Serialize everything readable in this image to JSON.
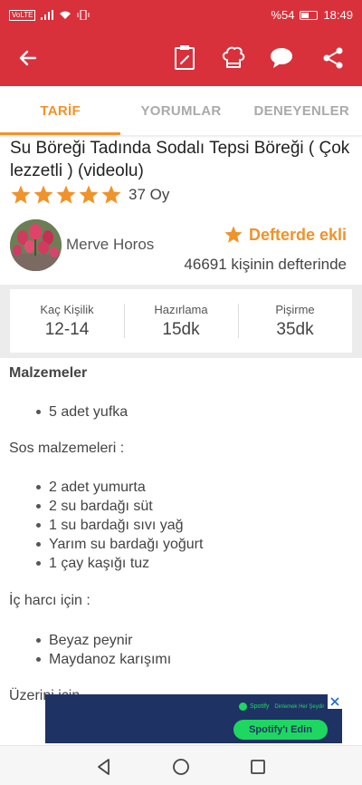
{
  "status_bar": {
    "carrier_badge": "VoLTE",
    "battery_percent": "%54",
    "battery_level": 0.54,
    "time": "18:49"
  },
  "toolbar": {
    "back_icon": "arrow-left-icon",
    "actions": [
      "notebook-icon",
      "chef-hat-icon",
      "chat-bubble-icon",
      "share-icon"
    ]
  },
  "tabs": [
    {
      "label": "TARİF",
      "active": true
    },
    {
      "label": "YORUMLAR",
      "active": false
    },
    {
      "label": "DENEYENLER",
      "active": false
    }
  ],
  "recipe": {
    "title": "Su Böreği Tadında Sodalı Tepsi Böreği ( Çok lezzetli ) (videolu)",
    "stars": 5,
    "vote_text": "37 Oy"
  },
  "author": {
    "name": "Merve Horos",
    "defter_label": "Defterde ekli",
    "defter_count_text": "46691 kişinin defterinde"
  },
  "info": [
    {
      "label": "Kaç Kişilik",
      "value": "12-14"
    },
    {
      "label": "Hazırlama",
      "value": "15dk"
    },
    {
      "label": "Pişirme",
      "value": "35dk"
    }
  ],
  "ingredients": {
    "heading": "Malzemeler",
    "main": [
      "5 adet yufka"
    ],
    "sauce_heading": "Sos malzemeleri :",
    "sauce": [
      "2 adet yumurta",
      "2 su bardağı süt",
      "1 su bardağı sıvı yağ",
      "Yarım su bardağı yoğurt",
      "1 çay kaşığı tuz"
    ],
    "filling_heading": "İç harcı için :",
    "filling": [
      "Beyaz peynir",
      " Maydanoz karışımı"
    ],
    "next_heading_partial": "Üzerini için"
  },
  "ad": {
    "brand": "Spotify",
    "tagline": "Dinlemek Her Şeydir",
    "cta": "Spotify'ı Edin"
  },
  "colors": {
    "primary": "#d8313b",
    "accent": "#f0932a",
    "ad_bg": "#1e3264",
    "spotify_green": "#1ed760"
  }
}
